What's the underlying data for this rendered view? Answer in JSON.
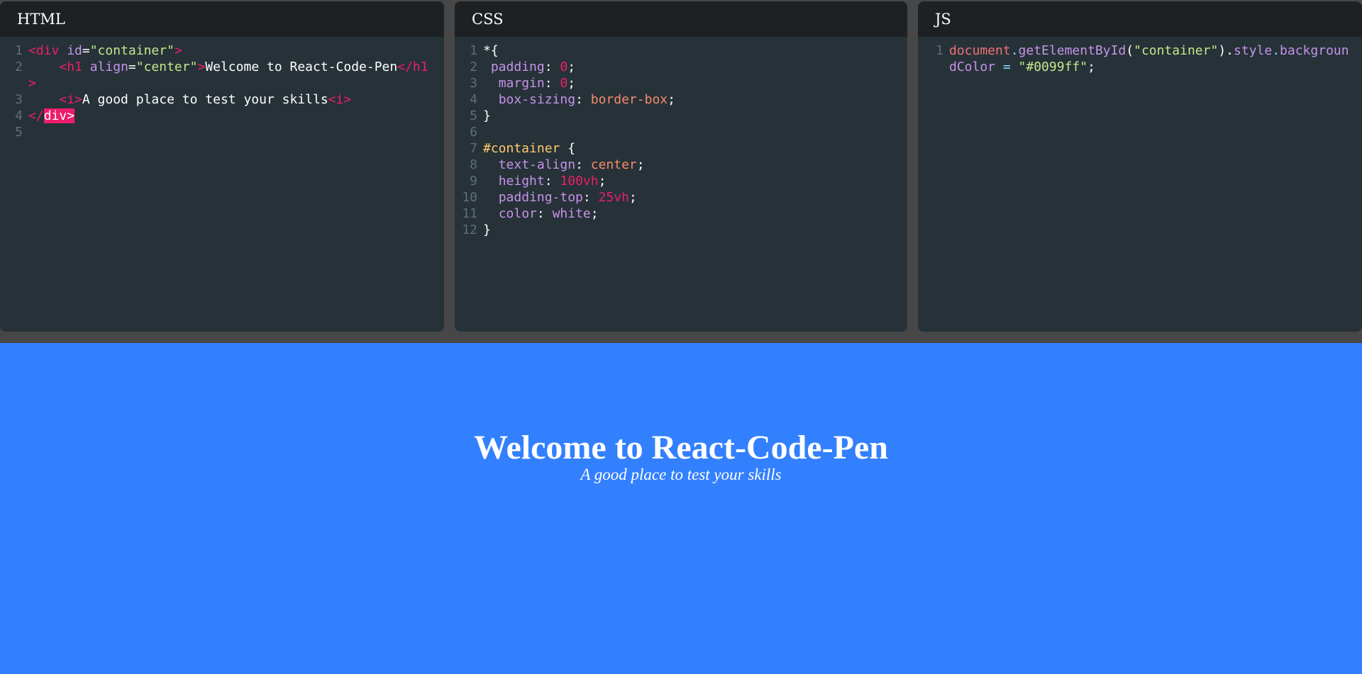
{
  "panes": {
    "html": {
      "title": "HTML"
    },
    "css": {
      "title": "CSS"
    },
    "js": {
      "title": "JS"
    }
  },
  "html_code": {
    "l1": [
      "<div ",
      "id",
      "=",
      "\"container\"",
      ">"
    ],
    "l2": [
      "    <h1 ",
      "align",
      "=",
      "\"center\"",
      ">",
      "Welcome to React-Code-Pen",
      "</h1>"
    ],
    "l3": [
      "    <i>",
      "A good place to test your skills",
      "<i>"
    ],
    "l4": [
      "</",
      "div>"
    ],
    "numbers": [
      "1",
      "2",
      "3",
      "4",
      "5"
    ]
  },
  "css_code": {
    "numbers": [
      "1",
      "2",
      "3",
      "4",
      "5",
      "6",
      "7",
      "8",
      "9",
      "10",
      "11",
      "12"
    ],
    "l1": "*{",
    "l2": [
      " padding",
      ": ",
      "0",
      ";"
    ],
    "l3": [
      "  margin",
      ": ",
      "0",
      ";"
    ],
    "l4": [
      "  box-sizing",
      ": ",
      "border-box",
      ";"
    ],
    "l5": "}",
    "l7": [
      "#container",
      " {"
    ],
    "l8": [
      "  text-align",
      ": ",
      "center",
      ";"
    ],
    "l9": [
      "  height",
      ": ",
      "100vh",
      ";"
    ],
    "l10": [
      "  padding-top",
      ": ",
      "25vh",
      ";"
    ],
    "l11": [
      "  color",
      ": ",
      "white",
      ";"
    ],
    "l12": "}"
  },
  "js_code": {
    "numbers": [
      "1"
    ],
    "l1": [
      "document",
      ".",
      "getElementById",
      "(",
      "\"container\"",
      ").",
      "style",
      ".",
      "backgroundColor",
      " = ",
      "\"#0099ff\"",
      ";"
    ]
  },
  "preview": {
    "heading": "Welcome to React-Code-Pen",
    "subtitle": "A good place to test your skills",
    "background": "#3380ff"
  }
}
